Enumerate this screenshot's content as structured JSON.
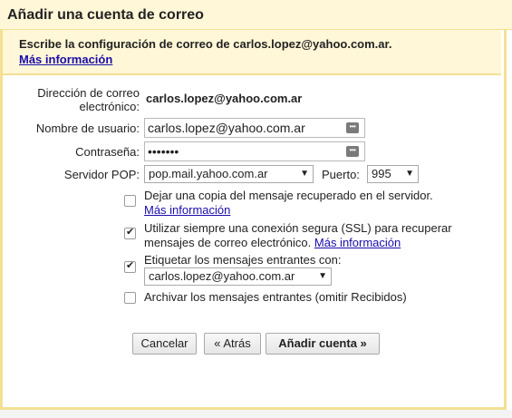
{
  "dialog": {
    "title": "Añadir una cuenta de correo",
    "intro": "Escribe la configuración de correo de carlos.lopez@yahoo.com.ar.",
    "intro_link": "Más información"
  },
  "form": {
    "email_label_line1": "Dirección de correo",
    "email_label_line2": "electrónico:",
    "email_value": "carlos.lopez@yahoo.com.ar",
    "username_label": "Nombre de usuario:",
    "username_value": "carlos.lopez@yahoo.com.ar",
    "password_label": "Contraseña:",
    "password_value": "•••••••",
    "pop_label": "Servidor POP:",
    "pop_value": "pop.mail.yahoo.com.ar",
    "port_label": "Puerto:",
    "port_value": "995"
  },
  "options": {
    "leave_copy": {
      "label": "Dejar una copia del mensaje recuperado en el servidor.",
      "link": "Más información",
      "checked": false
    },
    "ssl": {
      "label_line1": "Utilizar siempre una conexión segura (SSL) para recuperar",
      "label_line2": "mensajes de correo electrónico.",
      "link": "Más información",
      "checked": true
    },
    "label_incoming": {
      "label": "Etiquetar los mensajes entrantes con:",
      "select_value": "carlos.lopez@yahoo.com.ar",
      "checked": true
    },
    "archive": {
      "label": "Archivar los mensajes entrantes (omitir Recibidos)",
      "checked": false
    }
  },
  "buttons": {
    "cancel": "Cancelar",
    "back": "« Atrás",
    "add": "Añadir cuenta »"
  },
  "icons": {
    "password_manager": "password-dots-icon",
    "dropdown": "chevron-down-icon",
    "check": "check-icon"
  },
  "colors": {
    "title_bg": "#fff7d7",
    "border": "#f3e093",
    "link": "#1a0dab"
  }
}
